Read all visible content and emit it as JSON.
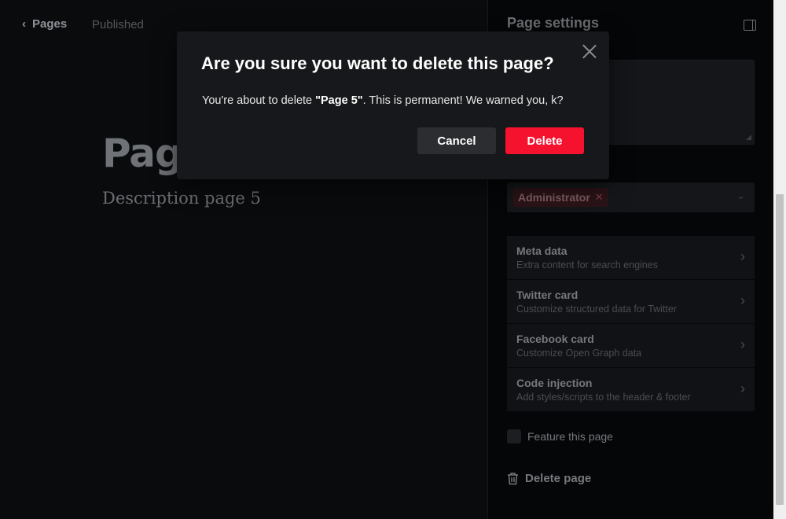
{
  "topbar": {
    "back_label": "Pages",
    "status": "Published"
  },
  "editor": {
    "title": "Page 5",
    "description": "Description page 5"
  },
  "panel": {
    "title": "Page settings",
    "access_tag": "Administrator",
    "menu": [
      {
        "title": "Meta data",
        "subtitle": "Extra content for search engines"
      },
      {
        "title": "Twitter card",
        "subtitle": "Customize structured data for Twitter"
      },
      {
        "title": "Facebook card",
        "subtitle": "Customize Open Graph data"
      },
      {
        "title": "Code injection",
        "subtitle": "Add styles/scripts to the header & footer"
      }
    ],
    "feature_label": "Feature this page",
    "delete_label": "Delete page"
  },
  "modal": {
    "title": "Are you sure you want to delete this page?",
    "text_before": "You're about to delete ",
    "page_name": "\"Page 5\"",
    "text_after": ". This is permanent! We warned you, k?",
    "cancel_label": "Cancel",
    "delete_label": "Delete"
  },
  "colors": {
    "delete_button": "#f5122f",
    "cancel_button": "#2b2d31",
    "modal_bg": "#17181b",
    "page_bg": "#0a0b0d"
  },
  "icons": {
    "back": "chevron-left-icon",
    "panel_toggle": "sidebar-toggle-icon",
    "close": "close-icon",
    "trash": "trash-icon",
    "menu_chevron": "chevron-right-icon",
    "select_chevron": "chevron-down-icon",
    "tag_remove": "x-icon"
  }
}
